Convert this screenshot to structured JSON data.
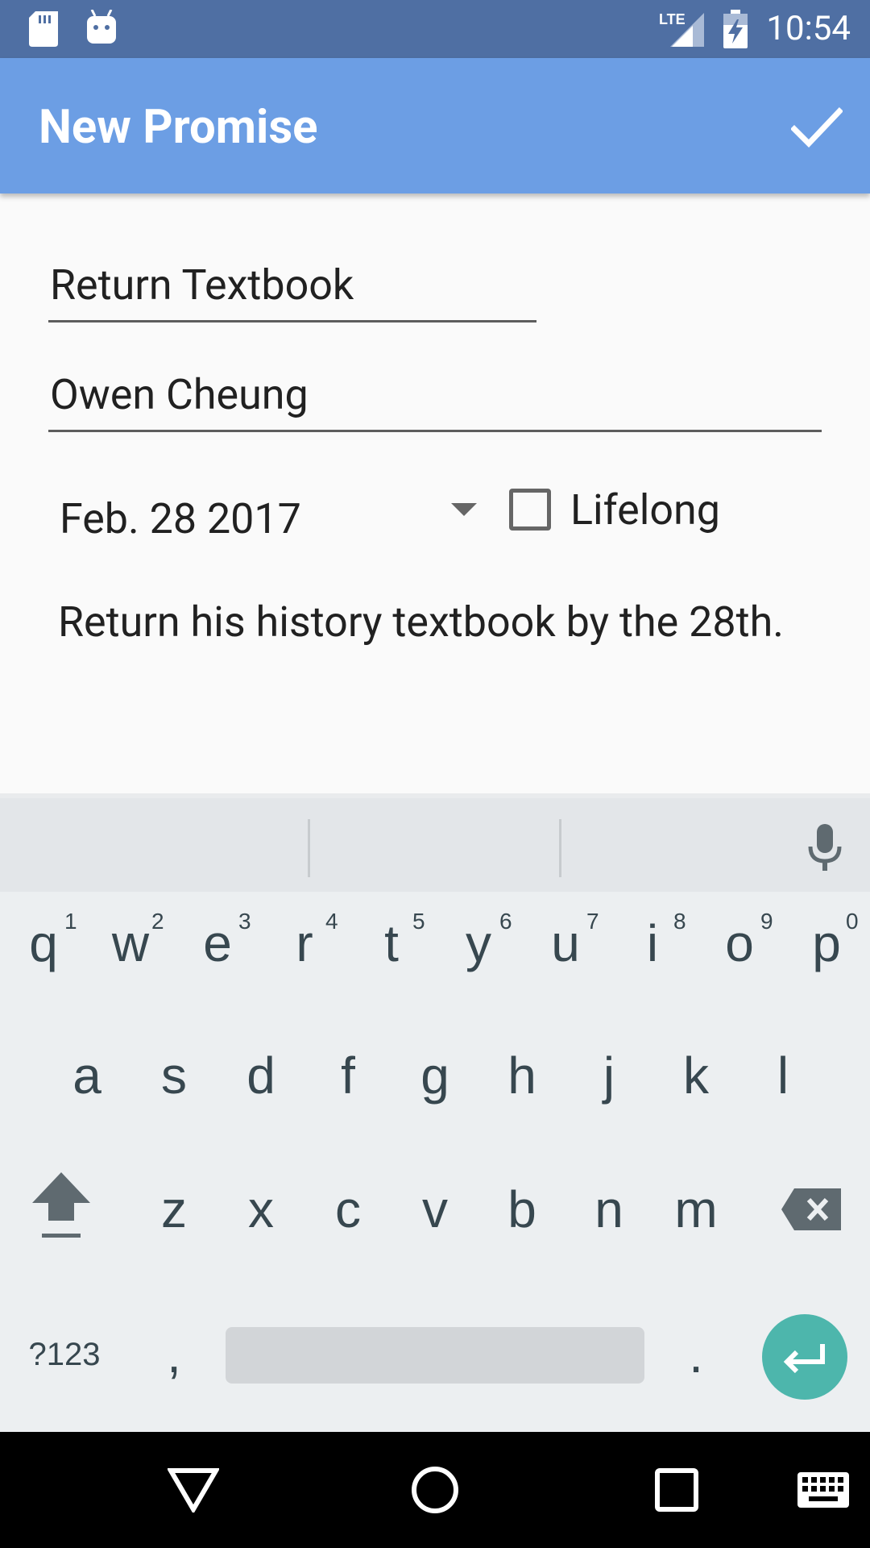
{
  "status_bar": {
    "time": "10:54",
    "network": "LTE",
    "icons": [
      "sd-card-icon",
      "android-icon",
      "lte-signal-icon",
      "battery-charging-icon"
    ]
  },
  "app_bar": {
    "title": "New Promise",
    "confirm_icon": "check-icon"
  },
  "form": {
    "title_value": "Return Textbook",
    "person_value": "Owen Cheung",
    "date_value": "Feb. 28 2017",
    "lifelong_label": "Lifelong",
    "lifelong_checked": false,
    "description": "Return his history textbook by the 28th."
  },
  "keyboard": {
    "row1": [
      "q",
      "w",
      "e",
      "r",
      "t",
      "y",
      "u",
      "i",
      "o",
      "p"
    ],
    "row1_hints": [
      "1",
      "2",
      "3",
      "4",
      "5",
      "6",
      "7",
      "8",
      "9",
      "0"
    ],
    "row2": [
      "a",
      "s",
      "d",
      "f",
      "g",
      "h",
      "j",
      "k",
      "l"
    ],
    "row3": [
      "z",
      "x",
      "c",
      "v",
      "b",
      "n",
      "m"
    ],
    "symbols_label": "?123",
    "comma": ",",
    "period": "."
  },
  "colors": {
    "status_bar": "#4f6fa3",
    "app_bar": "#6c9ee4",
    "enter_key": "#4db6ac",
    "keyboard_bg": "#eceff1"
  }
}
